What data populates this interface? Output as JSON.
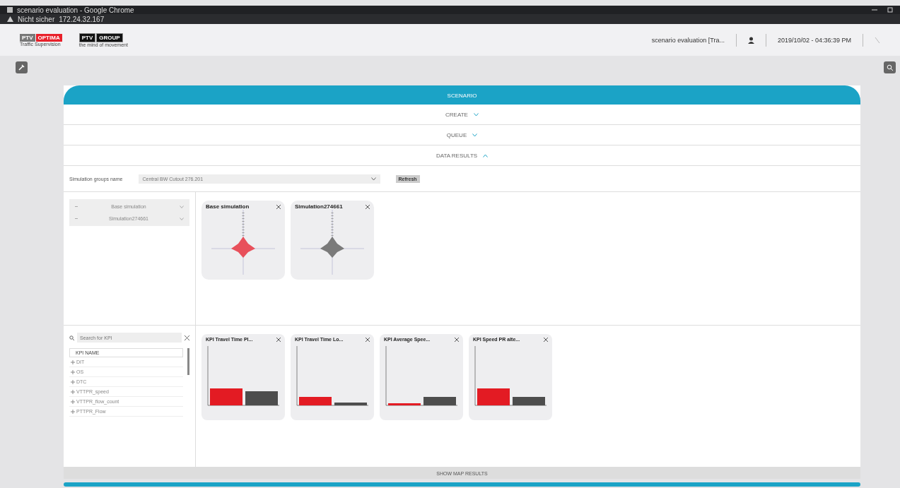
{
  "window": {
    "title": "scenario evaluation - Google Chrome",
    "security": "Nicht sicher",
    "url": "172.24.32.167"
  },
  "header": {
    "logos": [
      {
        "kind": "optima",
        "parts": [
          "PTV",
          "OPTIMA"
        ],
        "tagline": "Traffic Supervision"
      },
      {
        "kind": "group",
        "parts": [
          "PTV",
          "GROUP"
        ],
        "tagline": "the mind of movement"
      }
    ],
    "page": "scenario evaluation [Tra...",
    "datetime": "2019/10/02 - 04:36:39 PM"
  },
  "panel": {
    "title": "SCENARIO",
    "sections": [
      {
        "label": "CREATE",
        "expanded": false
      },
      {
        "label": "QUEUE",
        "expanded": false
      },
      {
        "label": "DATA RESULTS",
        "expanded": true
      }
    ],
    "group_label": "Simulation groups name",
    "group_value": "Central BW Cutout 276.201",
    "refresh": "Refresh",
    "simulations": [
      {
        "label": "Base simulation"
      },
      {
        "label": "Simulation274661"
      }
    ],
    "radar_cards": [
      {
        "title": "Base simulation",
        "color": "#e8505b"
      },
      {
        "title": "Simulation274661",
        "color": "#7a7a7a"
      }
    ],
    "kpi_search": {
      "placeholder": "Search for KPI"
    },
    "kpi_header": "KPI NAME",
    "kpi_items": [
      "DIT",
      "OS",
      "DTC",
      "VTTPR_speed",
      "VTTPR_flow_count",
      "PTTPR_Flow"
    ],
    "kpi_cards": [
      {
        "title": "KPI Travel Time Pl..."
      },
      {
        "title": "KPI Travel Time Lo..."
      },
      {
        "title": "KPI Average Spee..."
      },
      {
        "title": "KPI Speed PR alte..."
      }
    ],
    "footer": "SHOW MAP RESULTS"
  }
}
